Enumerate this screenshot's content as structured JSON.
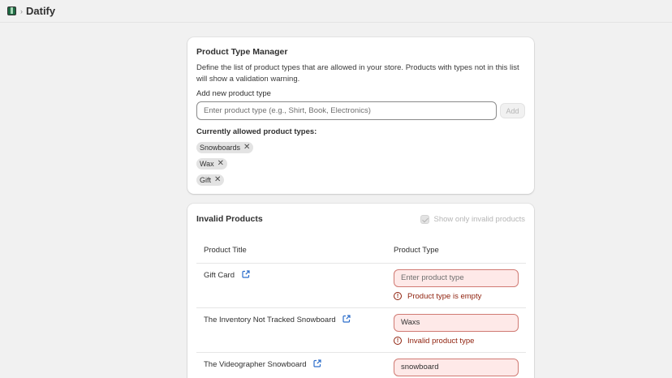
{
  "app": {
    "title": "Datify"
  },
  "type_manager": {
    "title": "Product Type Manager",
    "description": "Define the list of product types that are allowed in your store. Products with types not in this list will show a validation warning.",
    "add_label": "Add new product type",
    "input_placeholder": "Enter product type (e.g., Shirt, Book, Electronics)",
    "add_button": "Add",
    "allowed_label": "Currently allowed product types:",
    "allowed_types": [
      "Snowboards",
      "Wax",
      "Gift"
    ],
    "remove_glyph": "✕"
  },
  "invalid_products": {
    "title": "Invalid Products",
    "filter_label": "Show only invalid products",
    "filter_checked": true,
    "columns": [
      "Product Title",
      "Product Type"
    ],
    "rows": [
      {
        "title": "Gift Card",
        "type_value": "",
        "type_placeholder": "Enter product type",
        "error": "Product type is empty"
      },
      {
        "title": "The Inventory Not Tracked Snowboard",
        "type_value": "Waxs",
        "type_placeholder": "",
        "error": "Invalid product type"
      },
      {
        "title": "The Videographer Snowboard",
        "type_value": "snowboard",
        "type_placeholder": "",
        "error": ""
      }
    ]
  },
  "icons": {
    "app": "app-logo-icon",
    "external": "external-link-icon",
    "error": "alert-circle-icon",
    "remove": "close-icon"
  },
  "colors": {
    "error_bg": "#fee9e8",
    "error_text": "#8e1f0b",
    "link_icon": "#2c6ecb"
  }
}
